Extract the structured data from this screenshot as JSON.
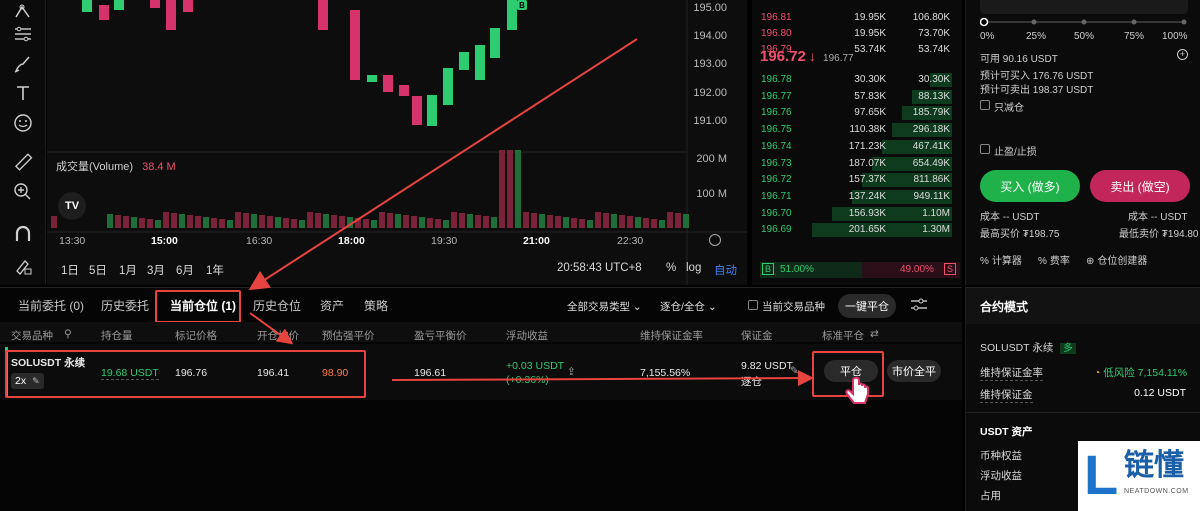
{
  "chart": {
    "price_ticks": [
      "195.00",
      "194.00",
      "193.00",
      "192.00",
      "191.00"
    ],
    "volume_label": "成交量(Volume)",
    "volume_value": "38.4 M",
    "volume_ticks": [
      "200 M",
      "100 M"
    ],
    "time_ticks": [
      "13:30",
      "15:00",
      "16:30",
      "18:00",
      "19:30",
      "21:00",
      "22:30"
    ],
    "timeframes": [
      "1日",
      "5日",
      "1月",
      "3月",
      "6月",
      "1年"
    ],
    "clock": "20:58:43 UTC+8",
    "pct": "%",
    "log": "log",
    "auto": "自动",
    "tv_logo": "TV",
    "candle_badge": "B"
  },
  "orderbook": {
    "asks": [
      {
        "price": "196.81",
        "qty": "19.95K",
        "total": "106.80K"
      },
      {
        "price": "196.80",
        "qty": "19.95K",
        "total": "73.70K"
      },
      {
        "price": "196.79",
        "qty": "53.74K",
        "total": "53.74K"
      }
    ],
    "last_price": "196.72",
    "last_arrow": "↓",
    "mark_price": "196.77",
    "bids": [
      {
        "price": "196.78",
        "qty": "30.30K",
        "total": "30.30K"
      },
      {
        "price": "196.77",
        "qty": "57.83K",
        "total": "88.13K"
      },
      {
        "price": "196.76",
        "qty": "97.65K",
        "total": "185.79K"
      },
      {
        "price": "196.75",
        "qty": "110.38K",
        "total": "296.18K"
      },
      {
        "price": "196.74",
        "qty": "171.23K",
        "total": "467.41K"
      },
      {
        "price": "196.73",
        "qty": "187.07K",
        "total": "654.49K"
      },
      {
        "price": "196.72",
        "qty": "157.37K",
        "total": "811.86K"
      },
      {
        "price": "196.71",
        "qty": "137.24K",
        "total": "949.11K"
      },
      {
        "price": "196.70",
        "qty": "156.93K",
        "total": "1.10M"
      },
      {
        "price": "196.69",
        "qty": "201.65K",
        "total": "1.30M"
      }
    ],
    "buy_label": "B",
    "buy_pct": "51.00%",
    "sell_pct": "49.00%",
    "sell_label": "S"
  },
  "trade": {
    "slider_ticks": [
      "0%",
      "25%",
      "50%",
      "75%",
      "100%"
    ],
    "available": "可用 90.16 USDT",
    "can_buy": "预计可买入 176.76 USDT",
    "can_sell": "预计可卖出 198.37 USDT",
    "reduce_only": "只减仓",
    "tp_sl": "止盈/止损",
    "buy_btn": "买入 (做多)",
    "sell_btn": "卖出 (做空)",
    "cost_left": "成本 -- USDT",
    "cost_right": "成本 -- USDT",
    "max_buy": "最高买价 ₮198.75",
    "min_sell": "最低卖价 ₮194.80",
    "tools": [
      "计算器",
      "费率",
      "仓位创建器"
    ]
  },
  "positions": {
    "tabs": [
      "当前委托 (0)",
      "历史委托",
      "当前仓位 (1)",
      "历史仓位",
      "资产",
      "策略"
    ],
    "filter_type": "全部交易类型",
    "filter_mode": "逐仓/全仓",
    "current_pair": "当前交易品种",
    "close_all": "一键平仓",
    "headers": [
      "交易品种",
      "持仓量",
      "标记价格",
      "开仓均价",
      "预估强平价",
      "盈亏平衡价",
      "浮动收益",
      "维持保证金率",
      "保证金",
      "标准平仓"
    ],
    "row": {
      "symbol": "SOLUSDT 永续",
      "leverage": "2x",
      "size": "19.68 USDT",
      "mark": "196.76",
      "entry": "196.41",
      "liq": "98.90",
      "breakeven": "196.61",
      "pnl": "+0.03 USDT",
      "pnl_pct": "(+0.36%)",
      "mmr": "7,155.56%",
      "margin": "9.82 USDT",
      "margin_mode": "逐仓",
      "close_btn": "平仓",
      "market_close_btn": "市价全平"
    }
  },
  "margin_panel": {
    "title": "合约模式",
    "pair": "SOLUSDT 永续",
    "pair_tag": "多",
    "mmr_label": "维持保证金率",
    "risk": "低风险 7,154.11%",
    "mm_label": "维持保证金",
    "mm_value": "0.12 USDT",
    "assets_title": "USDT 资产",
    "rows": [
      "币种权益",
      "浮动收益",
      "占用"
    ]
  },
  "logo": {
    "letter": "L",
    "cn": "链懂",
    "en": "NEATDOWN.COM"
  },
  "colors": {
    "up": "#2ecc71",
    "down": "#f0506e",
    "annotation": "#e8443f"
  }
}
